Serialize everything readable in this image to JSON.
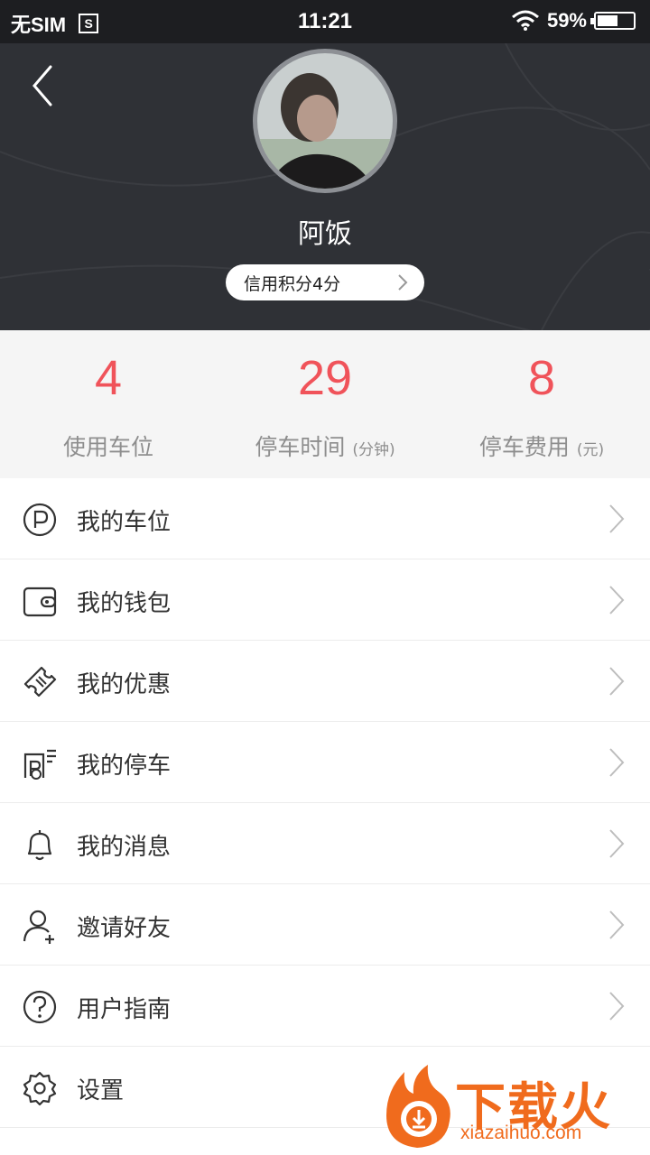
{
  "status_bar": {
    "carrier": "无SIM",
    "s_badge": "S",
    "time": "11:21",
    "battery": "59%",
    "battery_level": 0.59
  },
  "profile": {
    "username": "阿饭",
    "credit_label": "信用积分4分"
  },
  "stats": [
    {
      "value": "4",
      "label": "使用车位",
      "unit": ""
    },
    {
      "value": "29",
      "label": "停车时间",
      "unit": "(分钟)"
    },
    {
      "value": "8",
      "label": "停车费用",
      "unit": "(元)"
    }
  ],
  "menu": [
    {
      "label": "我的车位",
      "icon": "parking-icon"
    },
    {
      "label": "我的钱包",
      "icon": "wallet-icon"
    },
    {
      "label": "我的优惠",
      "icon": "coupon-icon"
    },
    {
      "label": "我的停车",
      "icon": "parking-record-icon"
    },
    {
      "label": "我的消息",
      "icon": "bell-icon"
    },
    {
      "label": "邀请好友",
      "icon": "add-user-icon"
    },
    {
      "label": "用户指南",
      "icon": "help-icon"
    },
    {
      "label": "设置",
      "icon": "gear-icon"
    }
  ],
  "watermark": {
    "brand": "下载火",
    "url": "xiazaihuo.com"
  },
  "colors": {
    "accent": "#f0535a",
    "header_bg": "#2f3136",
    "stats_bg": "#f5f5f5",
    "watermark": "#f06b1d"
  }
}
